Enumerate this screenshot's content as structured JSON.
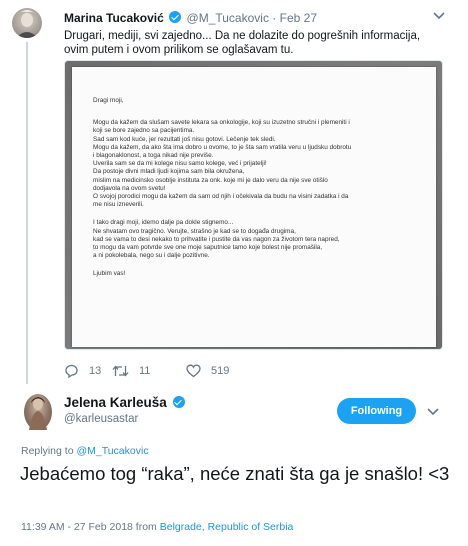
{
  "tweet1": {
    "author_name": "Marina Tucaković",
    "author_handle": "@M_Tucakovic",
    "separator": "·",
    "date": "Feb 27",
    "text": "Drugari, mediji, svi zajedno... Da ne dolazite do pogrešnih informacija, ovim putem i ovom prilikom se oglašavam tu.",
    "letter": {
      "greeting": "Dragi moji,",
      "paragraph1": [
        "Mogu da kažem da slušam savete lekara sa onkologije, koji su izuzetno stručni i plemeniti i",
        "koji se bore zajedno sa pacijentima.",
        "Sad sam kod kuće, jer rezultati još nisu gotovi. Lečenje tek sledi.",
        "Mogu da kažem, da ako šta ima dobro u ovome, to je šta sam vratila  veru u ljudsku dobrotu",
        "i blagonaklonost, a toga nikad nije previše.",
        "Uverila sam se da mi kolege nisu samo kolege, već i prijatelji!",
        "Da postoje divni mladi ljudi kojima sam bila okružena,",
        "mislim na medicinsko osoblje instituta za onk. koje mi je dalo veru da nije sve otišlo",
        "dodjavola na ovom svetu!",
        "O svojoj porodici mogu da kažem da sam od njih i očekivala da budu na visini zadatka i da",
        "me nisu izneverili."
      ],
      "paragraph2": [
        "I tako dragi moji, idemo dalje pa dokle stignemo...",
        "Ne shvatam ovo tragično. Verujte, strašno je kad se to događa drugima,",
        "kad se vama to desi nekako to prihvatite i pustite da vas nagon za životom tera napred,",
        "to mogu da vam potvrde sve one moje saputnice tamo koje bolest nije promašila,",
        "a ni pokolebala, nego su i dalje pozitivne."
      ],
      "closing": "Ljubim vas!"
    },
    "actions": {
      "replies": "13",
      "retweets": "11",
      "likes": "519"
    }
  },
  "tweet2": {
    "author_name": "Jelena Karleuša",
    "author_handle": "@karleusastar",
    "follow_label": "Following",
    "replying_prefix": "Replying to",
    "replying_to": "@M_Tucakovic",
    "text": "Jebaćemo tog “raka”, neće znati šta ga je snašlo! <3",
    "time": "11:39 AM - 27 Feb 2018 from",
    "location": "Belgrade, Republic of Serbia"
  },
  "colors": {
    "accent": "#1da1f2",
    "link": "#1b95e0",
    "muted": "#657786",
    "text": "#14171a"
  },
  "icons": [
    "verified-badge-icon",
    "chevron-down-icon",
    "reply-icon",
    "retweet-icon",
    "like-icon"
  ]
}
